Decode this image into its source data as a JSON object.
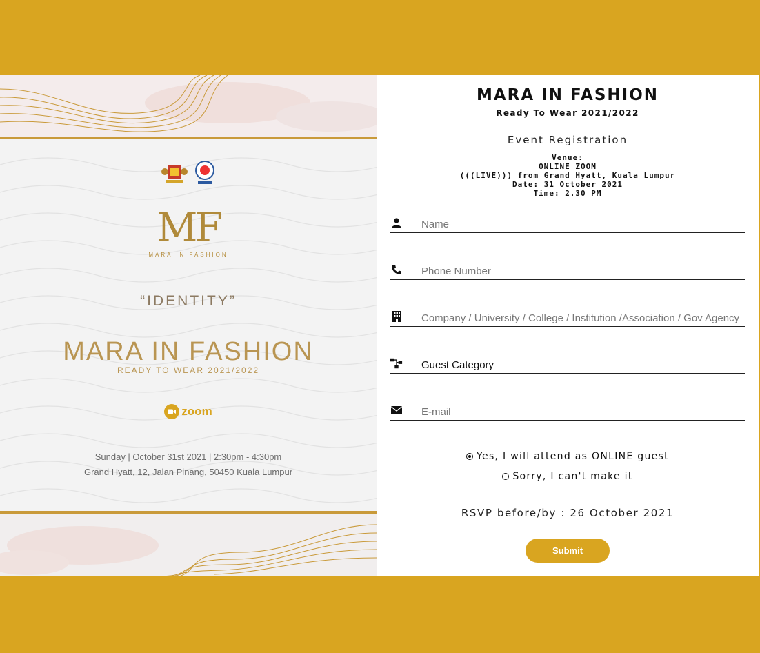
{
  "poster": {
    "brand_letters": "MF",
    "brand_subtitle": "MARA IN FASHION",
    "theme": "“IDENTITY”",
    "title": "MARA IN FASHION",
    "subtitle": "READY TO WEAR 2021/2022",
    "platform": "zoom",
    "date_line": "Sunday | October 31st 2021 | 2:30pm - 4:30pm",
    "address_line": "Grand Hyatt, 12, Jalan Pinang, 50450 Kuala Lumpur"
  },
  "header": {
    "title": "MARA IN FASHION",
    "subtitle": "Ready To Wear 2021/2022",
    "section": "Event Registration"
  },
  "venue": {
    "lines": [
      "Venue:",
      "ONLINE ZOOM",
      "(((LIVE))) from Grand Hyatt, Kuala Lumpur",
      "Date: 31 October 2021",
      "Time: 2.30 PM"
    ]
  },
  "form": {
    "fields": [
      {
        "icon": "user-icon",
        "placeholder": "Name",
        "value": ""
      },
      {
        "icon": "phone-icon",
        "placeholder": "Phone Number",
        "value": ""
      },
      {
        "icon": "building-icon",
        "placeholder": "Company / University / College / Institution /Association / Gov Agency",
        "value": ""
      },
      {
        "icon": "sitemap-icon",
        "placeholder": "",
        "value": "Guest Category"
      },
      {
        "icon": "envelope-icon",
        "placeholder": "E-mail",
        "value": ""
      }
    ],
    "attendance_options": [
      {
        "label": "Yes, I will attend as ONLINE guest",
        "selected": true
      },
      {
        "label": "Sorry, I can't make it",
        "selected": false
      }
    ],
    "rsvp": "RSVP before/by : 26 October 2021",
    "submit_label": "Submit"
  },
  "colors": {
    "accent": "#d9a520",
    "poster_gold": "#b99552"
  }
}
